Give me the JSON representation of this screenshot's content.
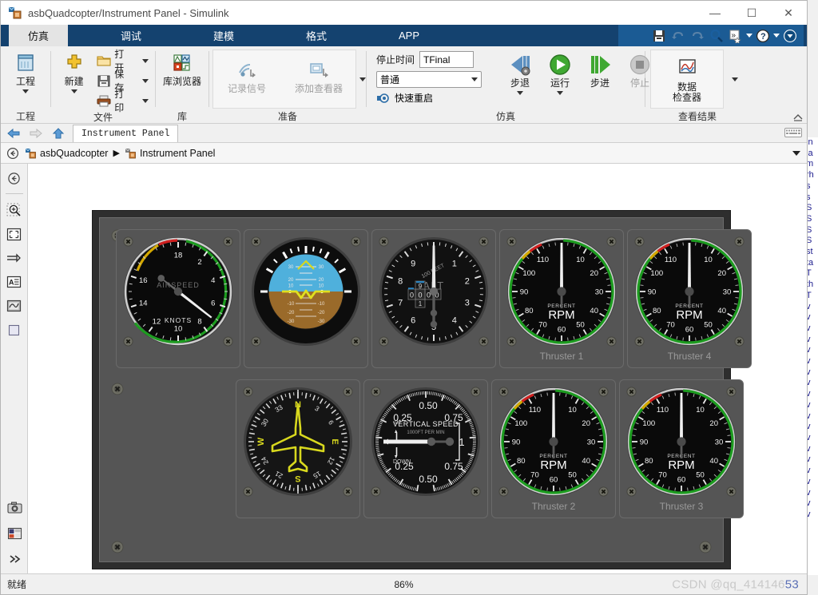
{
  "window": {
    "title": "asbQuadcopter/Instrument Panel - Simulink",
    "app_icon": "simulink-model-icon",
    "controls": {
      "minimize": "—",
      "maximize": "☐",
      "close": "✕"
    }
  },
  "ribbon": {
    "tabs": [
      {
        "label": "仿真",
        "active": true
      },
      {
        "label": "调试",
        "active": false
      },
      {
        "label": "建模",
        "active": false
      },
      {
        "label": "格式",
        "active": false
      },
      {
        "label": "APP",
        "active": false
      }
    ],
    "quick_access": [
      {
        "name": "save-icon",
        "label": "保存"
      },
      {
        "name": "undo-icon",
        "label": "撤销"
      },
      {
        "name": "redo-icon",
        "label": "重做"
      },
      {
        "name": "search-icon",
        "label": "搜索"
      },
      {
        "name": "favorites-icon",
        "label": "收藏夹"
      },
      {
        "name": "help-icon",
        "label": "帮助"
      },
      {
        "name": "expand-icon",
        "label": "展开"
      }
    ],
    "groups": [
      {
        "name": "project",
        "label": "工程",
        "big_buttons": [
          {
            "label": "工程",
            "icon": "project-icon",
            "has_dropdown": true
          }
        ]
      },
      {
        "name": "file",
        "label": "文件",
        "big_buttons": [
          {
            "label": "新建",
            "icon": "new-plus-icon",
            "has_dropdown": true
          }
        ],
        "small_buttons": [
          {
            "label": "打开",
            "icon": "folder-open-icon",
            "has_dropdown": true
          },
          {
            "label": "保存",
            "icon": "floppy-save-icon",
            "has_dropdown": true
          },
          {
            "label": "打印",
            "icon": "printer-icon",
            "has_dropdown": true
          }
        ]
      },
      {
        "name": "library",
        "label": "库",
        "big_buttons": [
          {
            "label": "库浏览器",
            "icon": "library-browser-icon",
            "has_dropdown": false
          }
        ]
      },
      {
        "name": "prepare",
        "label": "准备",
        "big_buttons": [
          {
            "label": "记录信号",
            "icon": "log-signal-icon",
            "disabled": true
          },
          {
            "label": "添加查看器",
            "icon": "add-viewer-icon",
            "disabled": true
          }
        ]
      },
      {
        "name": "simulate",
        "label": "仿真",
        "stop_time_label": "停止时间",
        "stop_time_value": "TFinal",
        "mode_value": "普通",
        "fast_restart_label": "快速重启",
        "buttons": [
          {
            "label": "步退",
            "icon": "step-back-icon",
            "has_dropdown": true,
            "disabled": false
          },
          {
            "label": "运行",
            "icon": "run-play-icon",
            "has_dropdown": true,
            "disabled": false
          },
          {
            "label": "步进",
            "icon": "step-forward-icon",
            "has_dropdown": false,
            "disabled": false
          },
          {
            "label": "停止",
            "icon": "stop-square-icon",
            "has_dropdown": false,
            "disabled": true
          }
        ]
      },
      {
        "name": "results",
        "label": "查看结果",
        "big_buttons": [
          {
            "label": "数据\n检查器",
            "line1": "数据",
            "line2": "检查器",
            "icon": "data-inspector-icon"
          }
        ]
      }
    ]
  },
  "nav": {
    "back_icon": "back-arrow-icon",
    "forward_icon": "forward-arrow-icon",
    "up_icon": "up-arrow-icon",
    "tab_label": "Instrument Panel",
    "keyboard_icon": "keyboard-icon"
  },
  "breadcrumb": {
    "back_icon": "breadcrumb-back-icon",
    "separator": "▶",
    "items": [
      {
        "label": "asbQuadcopter",
        "icon": "model-icon"
      },
      {
        "label": "Instrument Panel",
        "icon": "subsystem-icon"
      }
    ],
    "caret_icon": "chevron-down-icon"
  },
  "left_tools": [
    {
      "name": "navigate-back-icon"
    },
    {
      "name": "zoom-region-icon"
    },
    {
      "name": "fit-to-view-icon"
    },
    {
      "name": "signal-line-icon"
    },
    {
      "name": "annotation-text-icon"
    },
    {
      "name": "scope-icon"
    },
    {
      "name": "blank-area-icon"
    },
    {
      "name": "camera-snapshot-icon"
    },
    {
      "name": "layout-panels-icon"
    },
    {
      "name": "more-chevrons-icon"
    }
  ],
  "instrument_panel": {
    "gauges": [
      {
        "type": "airspeed",
        "name": "airspeed-indicator",
        "title": "AIRSPEED",
        "units": "KNOTS",
        "ticks": [
          2,
          4,
          6,
          8,
          10,
          12,
          14,
          16,
          18
        ],
        "value": 0,
        "caption": ""
      },
      {
        "type": "artificial-horizon",
        "name": "artificial-horizon",
        "pitch_labels": [
          30,
          20,
          10,
          -10,
          -20,
          -30
        ],
        "sky_color": "#4fb0dc",
        "ground_color": "#9a6a2a",
        "value": 0,
        "caption": ""
      },
      {
        "type": "altimeter",
        "name": "altimeter",
        "title": "ALT",
        "units": "100 FEET",
        "ticks": [
          1,
          2,
          3,
          4,
          5,
          6,
          7,
          8,
          9
        ],
        "counter": [
          "0",
          "0",
          "0",
          "0"
        ],
        "drum_upper": "9",
        "drum_lower": "1",
        "value": 0,
        "caption": ""
      },
      {
        "type": "rpm",
        "name": "rpm-gauge-thruster-1",
        "title": "RPM",
        "units": "PERCENT",
        "ticks": [
          10,
          20,
          30,
          40,
          50,
          60,
          70,
          80,
          90,
          100,
          110
        ],
        "value": 0,
        "caption": "Thruster 1"
      },
      {
        "type": "rpm",
        "name": "rpm-gauge-thruster-4",
        "title": "RPM",
        "units": "PERCENT",
        "ticks": [
          10,
          20,
          30,
          40,
          50,
          60,
          70,
          80,
          90,
          100,
          110
        ],
        "value": 0,
        "caption": "Thruster 4"
      },
      {
        "type": "heading",
        "name": "heading-indicator",
        "cardinals": [
          "N",
          "E",
          "S",
          "W"
        ],
        "numerals": [
          3,
          6,
          12,
          15,
          21,
          24,
          30,
          33
        ],
        "value": 0,
        "caption": ""
      },
      {
        "type": "vertical-speed",
        "name": "vertical-speed-indicator",
        "title": "VERTICAL SPEED",
        "units": "1000FT PER MIN",
        "up_label": "UP",
        "down_label": "DOWN",
        "ticks": [
          "0.25",
          "0.50",
          "0.75",
          "1"
        ],
        "value": 0,
        "caption": ""
      },
      {
        "type": "rpm",
        "name": "rpm-gauge-thruster-2",
        "title": "RPM",
        "units": "PERCENT",
        "ticks": [
          10,
          20,
          30,
          40,
          50,
          60,
          70,
          80,
          90,
          100,
          110
        ],
        "value": 0,
        "caption": "Thruster 2"
      },
      {
        "type": "rpm",
        "name": "rpm-gauge-thruster-3",
        "title": "RPM",
        "units": "PERCENT",
        "ticks": [
          10,
          20,
          30,
          40,
          50,
          60,
          70,
          80,
          90,
          100,
          110
        ],
        "value": 0,
        "caption": "Thruster 3"
      }
    ]
  },
  "statusbar": {
    "status": "就绪",
    "zoom": "86%",
    "watermark_prefix": "CSDN @qq_414146",
    "watermark_suffix": "53"
  },
  "background_list": [
    "in",
    "la",
    "m",
    "rh",
    "s",
    "s",
    "S",
    "S",
    "S",
    "S",
    "st",
    "ta",
    "T",
    "th",
    "T",
    "v",
    "v",
    "v",
    "v",
    "v",
    "v",
    "v",
    "v",
    "v",
    "v",
    "v",
    "v",
    "v",
    "v",
    "v",
    "v",
    "v",
    "v",
    "v",
    "v"
  ],
  "colors": {
    "ribbon_blue": "#14426f",
    "qat_blue": "#1b5b94",
    "panel_frame": "#2e2e2e",
    "panel_face": "#555555",
    "gauge_green": "#22a024",
    "gauge_yellow": "#d9a300",
    "gauge_red": "#d32020",
    "needle": "#f2f2f2",
    "aircraft_yellow": "#d8d81e"
  }
}
